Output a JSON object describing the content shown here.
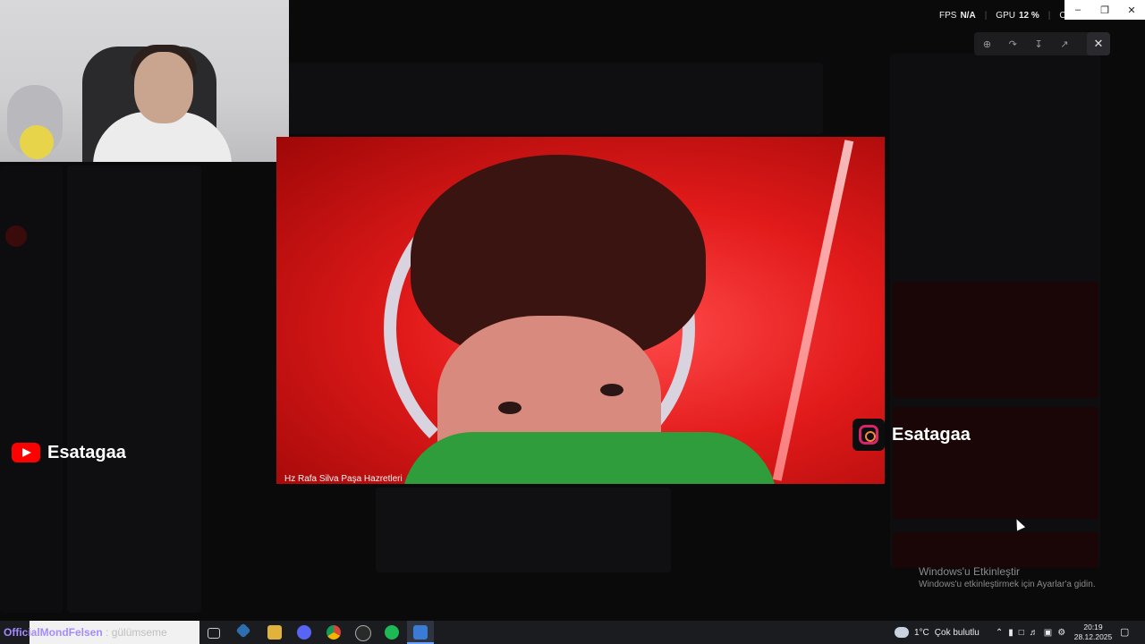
{
  "stream_overlay": {
    "youtube_handle": "Esatagaa",
    "instagram_handle": "Esatagaa",
    "video_caption": "Hz Rafa Silva Paşa Hazretleri",
    "chat_name": "OfficialMondFelsen",
    "chat_message": "gülümseme",
    "stats": {
      "fps_label": "FPS",
      "fps_value": "N/A",
      "gpu_label": "GPU",
      "gpu_value": "12 %",
      "cpu_label": "CPU"
    }
  },
  "windows_activation": {
    "title": "Windows'u Etkinleştir",
    "subtitle": "Windows'u etkinleştirmek için Ayarlar'a gidin."
  },
  "taskbar": {
    "weather_temp": "1°C",
    "weather_desc": "Çok bulutlu",
    "time": "20:19",
    "date": "28.12.2025",
    "icons": [
      "task-view-icon",
      "kodi-icon",
      "file-explorer-icon",
      "discord-icon",
      "chrome-icon",
      "obs-icon",
      "spotify-icon",
      "active-app-icon"
    ]
  },
  "colors": {
    "youtube_red": "#ff0000",
    "instagram_pink": "#d6256d",
    "chat_name_purple": "#a58bff",
    "video_red": "#e21a1a",
    "taskbar_bg": "#1b1c20"
  }
}
